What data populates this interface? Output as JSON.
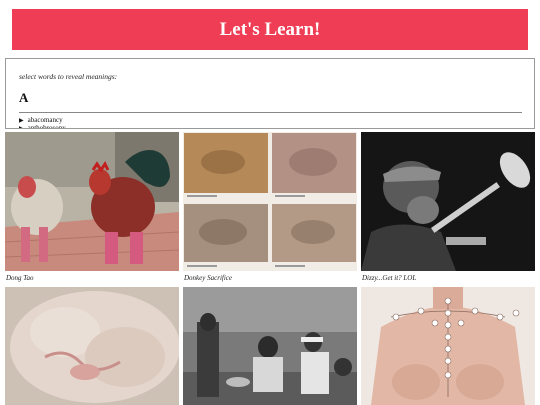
{
  "header": {
    "title": "Let's Learn!"
  },
  "panel": {
    "hint": "select words to reveal meanings:",
    "letter": "A",
    "words": [
      "abacomancy",
      "anthobrosopy"
    ]
  },
  "gallery": {
    "items": [
      {
        "caption": "Dong Tao"
      },
      {
        "caption": "Donkey Sacrifice"
      },
      {
        "caption": "Dizzy...Get it? LOL"
      },
      {
        "caption": ""
      },
      {
        "caption": ""
      },
      {
        "caption": ""
      }
    ]
  },
  "colors": {
    "banner": "#ee3d55"
  }
}
